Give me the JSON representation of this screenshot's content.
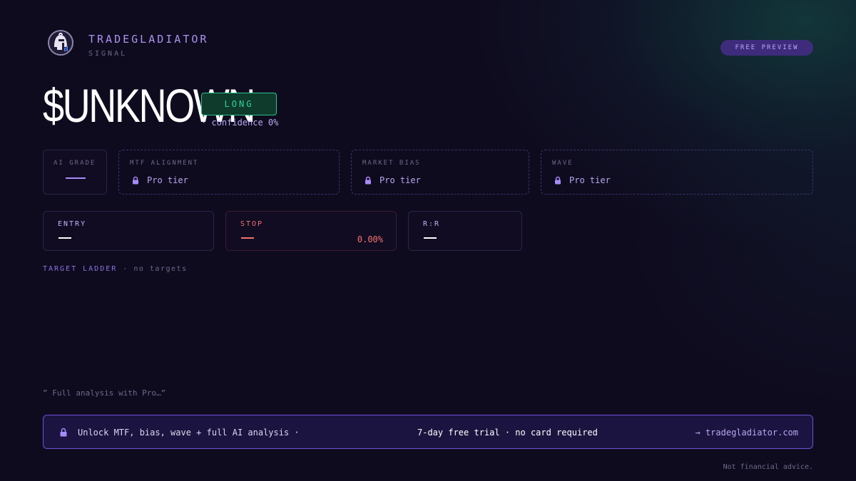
{
  "header": {
    "brand_name": "TRADEGLADIATOR",
    "brand_sub": "SIGNAL",
    "preview_badge": "FREE PREVIEW"
  },
  "signal": {
    "ticker": "$UNKNOWN",
    "direction": "LONG",
    "confidence": "· confidence 0%"
  },
  "metrics_row1": {
    "ai_grade": {
      "label": "AI GRADE"
    },
    "mtf": {
      "label": "MTF ALIGNMENT",
      "value": "Pro tier"
    },
    "bias": {
      "label": "MARKET BIAS",
      "value": "Pro tier"
    },
    "wave": {
      "label": "WAVE",
      "value": "Pro tier"
    }
  },
  "metrics_row2": {
    "entry": {
      "label": "ENTRY"
    },
    "stop": {
      "label": "STOP",
      "pct": "0.00%"
    },
    "rr": {
      "label": "R:R"
    }
  },
  "ladder": {
    "label": "TARGET LADDER",
    "sub": "· no targets"
  },
  "quote": "” Full analysis with Pro…”",
  "cta": {
    "left": "Unlock MTF, bias, wave + full AI analysis ·",
    "mid": "7-day free trial · no card required",
    "right": "→ tradegladiator.com"
  },
  "disclaimer": "Not financial advice.",
  "colors": {
    "background": "#0f0b1f",
    "accent": "#a78bfa",
    "long": "#34d399",
    "stop": "#f47171",
    "cta_border": "#6d51d6"
  }
}
